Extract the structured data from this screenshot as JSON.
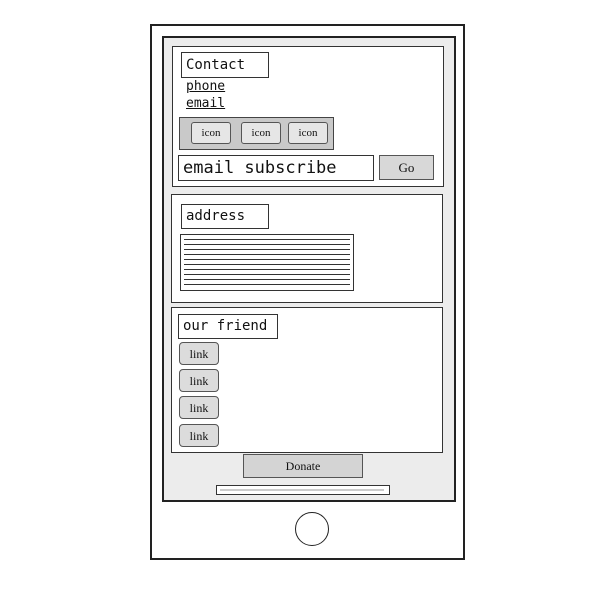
{
  "contact": {
    "heading": "Contact",
    "phone": "phone",
    "email": "email",
    "icons": [
      {
        "label": "icon"
      },
      {
        "label": "icon"
      },
      {
        "label": "icon"
      }
    ],
    "subscribe_value": "email subscribe",
    "go_label": "Go"
  },
  "address": {
    "heading": "address"
  },
  "friends": {
    "heading": "our friend",
    "links": [
      {
        "label": "link"
      },
      {
        "label": "link"
      },
      {
        "label": "link"
      },
      {
        "label": "link"
      }
    ]
  },
  "donate_label": "Donate",
  "colors": {
    "screen_bg": "#ececec",
    "button_bg": "#d8d8d8",
    "border": "#222222"
  }
}
